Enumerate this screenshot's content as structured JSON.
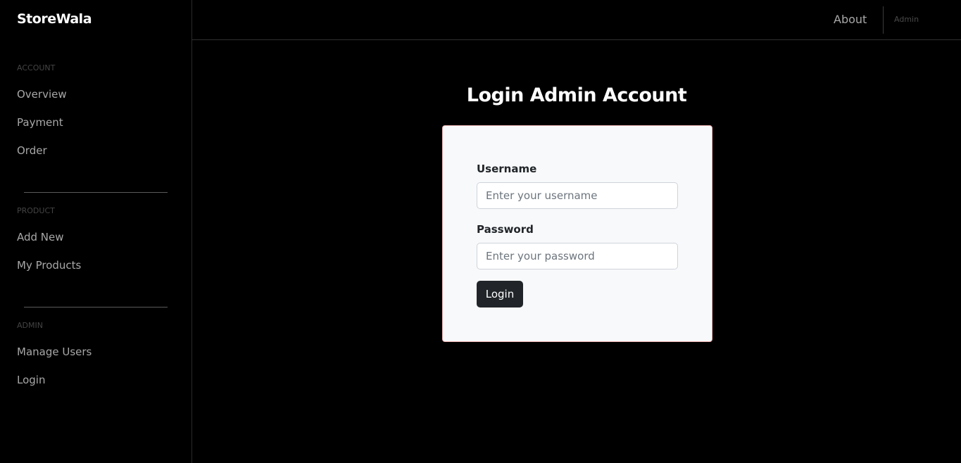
{
  "app": {
    "brand": "StoreWala"
  },
  "sidebar": {
    "sections": [
      {
        "heading": "ACCOUNT",
        "items": [
          "Overview",
          "Payment",
          "Order"
        ]
      },
      {
        "heading": "PRODUCT",
        "items": [
          "Add New",
          "My Products"
        ]
      },
      {
        "heading": "ADMIN",
        "items": [
          "Manage Users",
          "Login"
        ]
      }
    ]
  },
  "topbar": {
    "about": "About",
    "admin": "Admin"
  },
  "main": {
    "title": "Login Admin Account",
    "form": {
      "username_label": "Username",
      "username_placeholder": "Enter your username",
      "username_value": "",
      "password_label": "Password",
      "password_placeholder": "Enter your password",
      "password_value": "",
      "submit_label": "Login"
    }
  },
  "colors": {
    "background": "#000000",
    "card_background": "#f8f9fa",
    "card_border": "#f0b4b4",
    "button_background": "#212529",
    "nav_text": "#a8a8a8",
    "section_heading": "#444444"
  }
}
